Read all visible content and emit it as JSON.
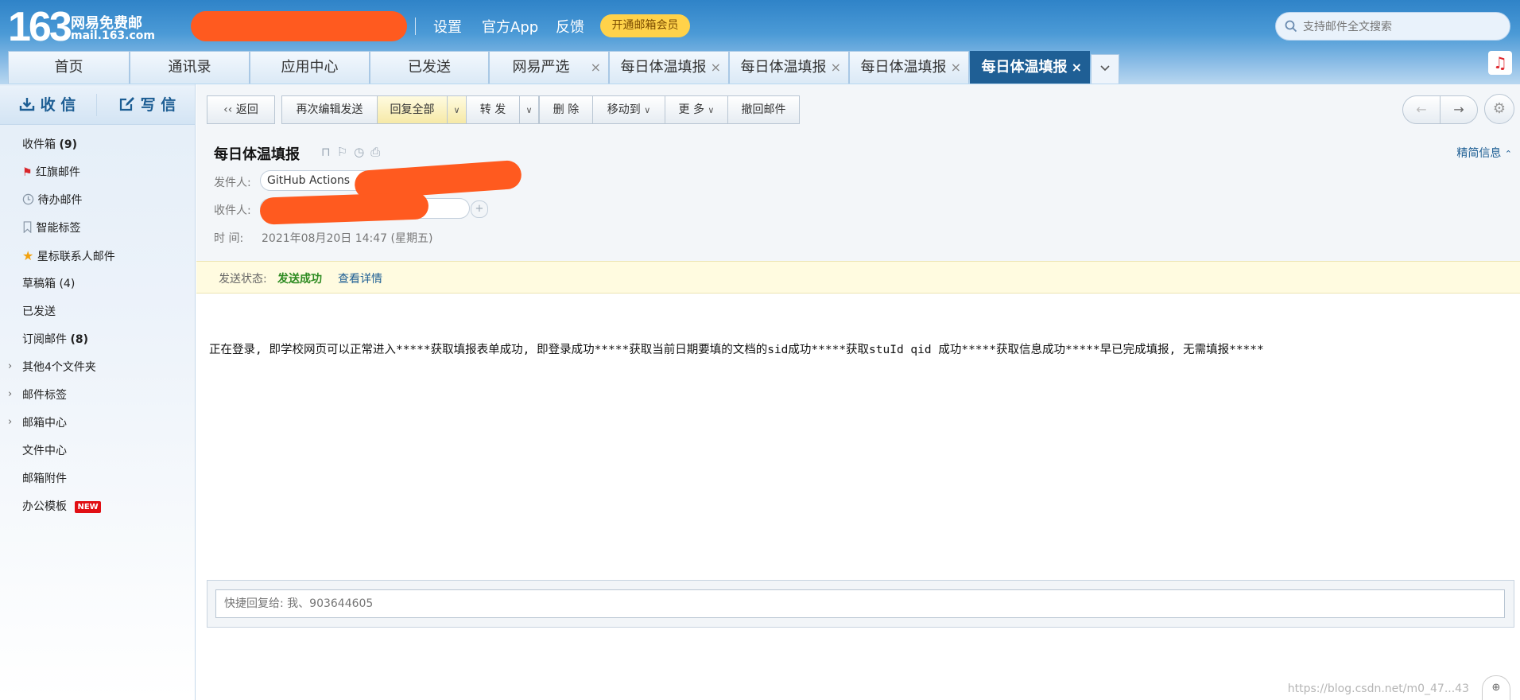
{
  "brand": {
    "logo_number": "163",
    "logo_name": "网易免费邮",
    "logo_domain": "mail.163.com"
  },
  "topnav": {
    "settings": "设置",
    "app": "官方App",
    "feedback": "反馈",
    "vip": "开通邮箱会员"
  },
  "search": {
    "placeholder": "支持邮件全文搜索"
  },
  "tabs": [
    {
      "label": "首页"
    },
    {
      "label": "通讯录"
    },
    {
      "label": "应用中心"
    },
    {
      "label": "已发送"
    },
    {
      "label": "网易严选",
      "close": "×"
    },
    {
      "label": "每日体温填报",
      "close": "×"
    },
    {
      "label": "每日体温填报",
      "close": "×"
    },
    {
      "label": "每日体温填报",
      "close": "×"
    },
    {
      "label": "每日体温填报",
      "close": "×"
    }
  ],
  "sidebar": {
    "receive": "收 信",
    "compose": "写 信",
    "items": [
      {
        "label": "收件箱",
        "count": "(9)"
      },
      {
        "label": "红旗邮件"
      },
      {
        "label": "待办邮件"
      },
      {
        "label": "智能标签"
      },
      {
        "label": "星标联系人邮件"
      },
      {
        "label": "草稿箱",
        "count": "(4)"
      },
      {
        "label": "已发送"
      },
      {
        "label": "订阅邮件",
        "count": "(8)"
      },
      {
        "label": "其他4个文件夹"
      },
      {
        "label": "邮件标签"
      },
      {
        "label": "邮箱中心"
      },
      {
        "label": "文件中心"
      },
      {
        "label": "邮箱附件"
      },
      {
        "label": "办公模板",
        "badge": "NEW"
      }
    ]
  },
  "toolbar": {
    "back": "返回",
    "reedit": "再次编辑发送",
    "reply_all": "回复全部",
    "forward": "转 发",
    "delete": "删 除",
    "move": "移动到",
    "more": "更 多",
    "recall": "撤回邮件"
  },
  "mail": {
    "subject": "每日体温填报",
    "sender_label": "发件人:",
    "sender_name": "GitHub Actions",
    "recipient_label": "收件人:",
    "time_label": "时 间:",
    "time_value": "2021年08月20日 14:47 (星期五)",
    "toggle_detail": "精简信息",
    "status_label": "发送状态:",
    "status_value": "发送成功",
    "status_link": "查看详情",
    "body": "正在登录, 即学校网页可以正常进入*****获取填报表单成功, 即登录成功*****获取当前日期要填的文档的sid成功*****获取stuId qid 成功*****获取信息成功*****早已完成填报, 无需填报*****"
  },
  "quick_reply": {
    "placeholder": "快捷回复给: 我、903644605"
  },
  "watermark": "https://blog.csdn.net/m0_47...43",
  "colors": {
    "header_blue": "#2f83c8",
    "active_tab": "#1f5f95",
    "success_green": "#2e8b21",
    "redaction": "#ff5a1f"
  }
}
